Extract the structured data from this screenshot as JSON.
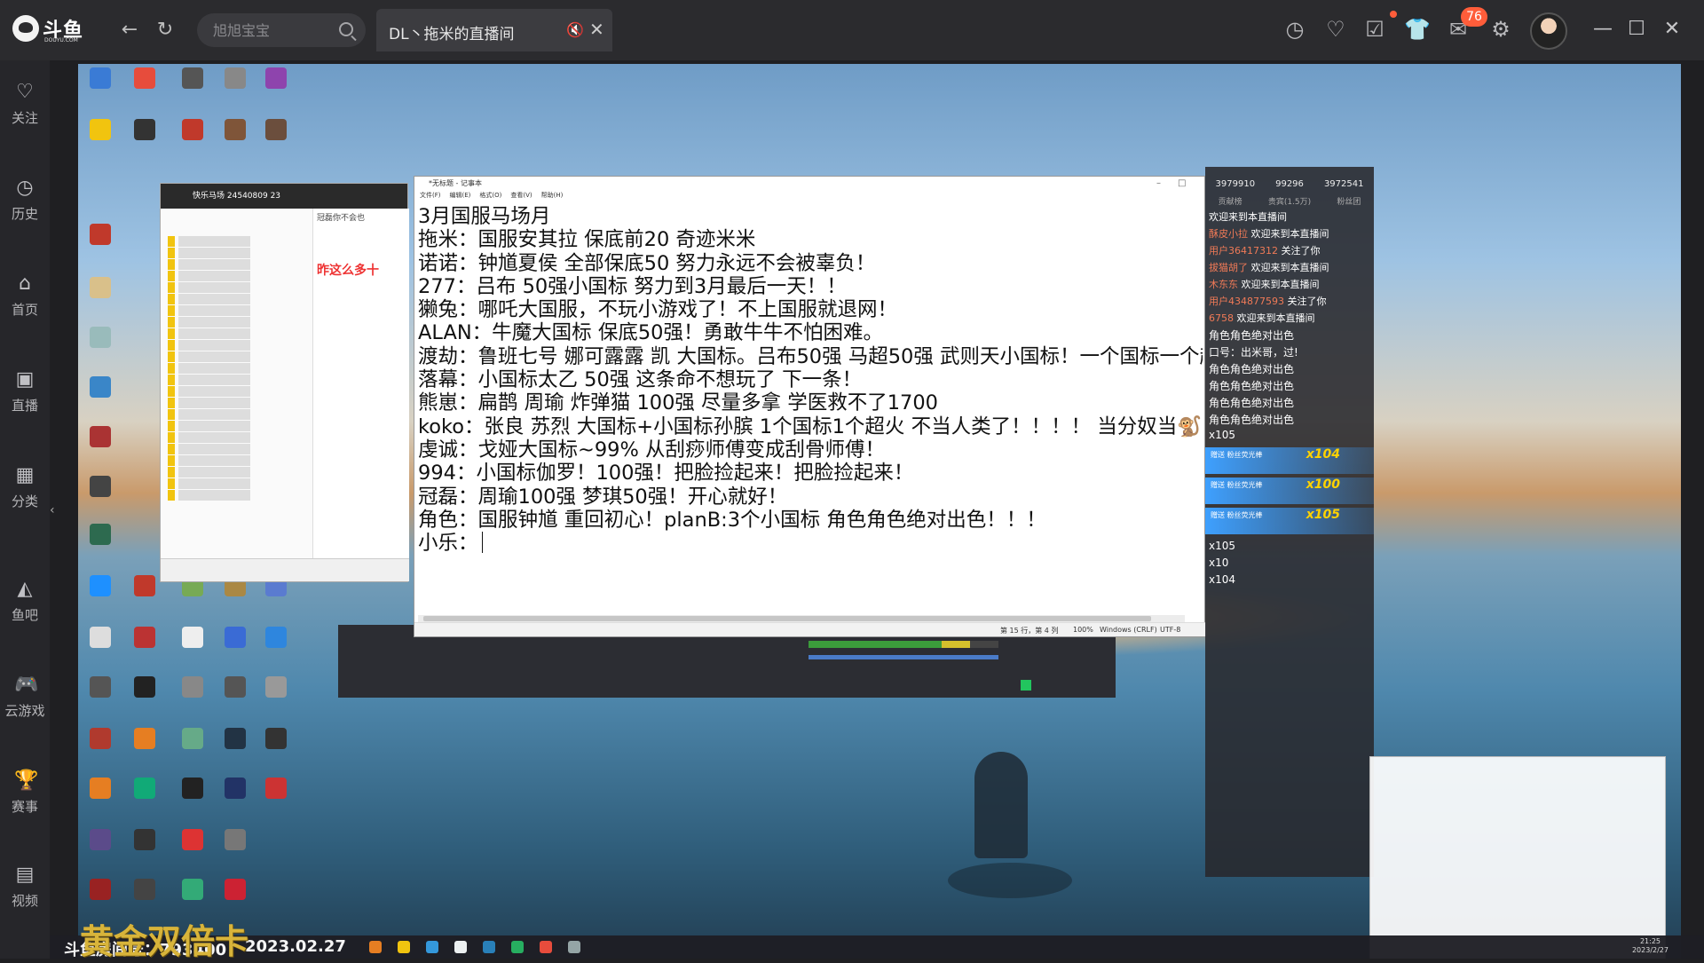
{
  "app": {
    "logo": "斗鱼",
    "logo_sub": "DOUYU.COM"
  },
  "search": {
    "placeholder": "旭旭宝宝"
  },
  "tab": {
    "title": "DL丶拖米的直播间"
  },
  "topbar": {
    "badge": "76"
  },
  "sidebar": {
    "items": [
      {
        "label": "关注",
        "icon": "heart-icon"
      },
      {
        "label": "历史",
        "icon": "clock-icon"
      },
      {
        "label": "首页",
        "icon": "home-icon"
      },
      {
        "label": "直播",
        "icon": "live-icon"
      },
      {
        "label": "分类",
        "icon": "grid-icon"
      },
      {
        "label": "鱼吧",
        "icon": "fishbar-icon"
      },
      {
        "label": "云游戏",
        "icon": "gamepad-icon"
      },
      {
        "label": "赛事",
        "icon": "trophy-icon"
      },
      {
        "label": "视频",
        "icon": "video-icon"
      }
    ]
  },
  "notepad": {
    "title": "*无标题 - 记事本",
    "menu": [
      "文件(F)",
      "编辑(E)",
      "格式(O)",
      "查看(V)",
      "帮助(H)"
    ],
    "lines": [
      "3月国服马场月",
      "拖米：国服安其拉 保底前20 奇迹米米",
      "诺诺：钟馗夏侯 全部保底50 努力永远不会被辜负！",
      "277：吕布 50强小国标 努力到3月最后一天！！",
      "獭兔：哪吒大国服，不玩小游戏了！不上国服就退网！",
      "ALAN：牛魔大国标 保底50强！勇敢牛牛不怕困难。",
      "渡劫：鲁班七号 娜可露露 凯 大国标。吕布50强 马超50强 武则天小国标！一个国标一个超火 马场之",
      "落幕：小国标太乙 50强 这条命不想玩了 下一条！",
      "熊崽：扁鹊 周瑜 炸弹猫 100强 尽量多拿 学医救不了1700",
      "koko：张良 苏烈 大国标+小国标孙膑 1个国标1个超火 不当人类了！！！！ 当分奴当🐒！",
      "虔诚：戈娅大国标~99% 从刮痧师傅变成刮骨师傅！",
      "994：小国标伽罗！100强！把脸捡起来！把脸捡起来！",
      "冠磊：周瑜100强 梦琪50强！开心就好！",
      "角色：国服钟馗 重回初心！planB:3个小国标 角色角色绝对出色！！！",
      "小乐："
    ],
    "status": {
      "position": "第 15 行，第 4 列",
      "zoom": "100%",
      "eol": "Windows (CRLF)",
      "encoding": "UTF-8"
    }
  },
  "qq": {
    "group_name": "快乐马场",
    "group_id": "24540809",
    "member_count": "23",
    "chat_messages": [
      "冠磊你不会也",
      "昨这么多十"
    ]
  },
  "danmu": {
    "stats": [
      "3979910",
      "99296",
      "3972541"
    ],
    "tabs": [
      "贡献榜",
      "贵宾(1.5万)",
      "粉丝团"
    ],
    "messages": [
      {
        "user": "",
        "text": "欢迎来到本直播间"
      },
      {
        "user": "酥皮小拉",
        "text": "欢迎来到本直播间"
      },
      {
        "user": "用户36417312",
        "text": "关注了你"
      },
      {
        "user": "拔猫胡了",
        "text": "欢迎来到本直播间"
      },
      {
        "user": "木东东",
        "text": "欢迎来到本直播间"
      },
      {
        "user": "用户434877593",
        "text": "关注了你"
      },
      {
        "user": "6758",
        "text": "欢迎来到本直播间"
      }
    ],
    "chat_lines": [
      "角色角色绝对出色",
      "口号：出米哥，过!",
      "角色角色绝对出色",
      "角色角色绝对出色",
      "角色角色绝对出色",
      "角色角色绝对出色"
    ],
    "gifts": [
      {
        "text": "赠送 粉丝荧光棒",
        "count": "x104"
      },
      {
        "text": "赠送 粉丝荧光棒",
        "count": "x100"
      },
      {
        "text": "赠送 粉丝荧光棒",
        "count": "x105"
      }
    ],
    "gift_counts": [
      "x105",
      "x105",
      "x10",
      "x104"
    ]
  },
  "overlay": {
    "caption": "黄金双倍卡",
    "room_label": "斗鱼房间号：793400",
    "date": "2023.02.27"
  },
  "clock": {
    "time": "21:25",
    "date": "2023/2/27"
  }
}
